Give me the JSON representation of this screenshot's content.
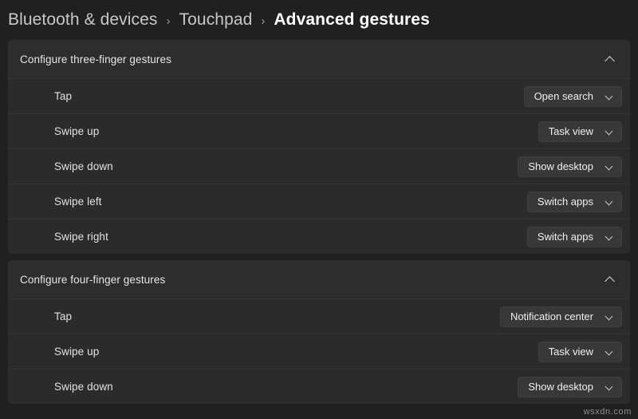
{
  "breadcrumb": {
    "separator": "›",
    "items": [
      {
        "label": "Bluetooth & devices",
        "current": false
      },
      {
        "label": "Touchpad",
        "current": false
      },
      {
        "label": "Advanced gestures",
        "current": true
      }
    ]
  },
  "sections": [
    {
      "title": "Configure three-finger gestures",
      "collapse_icon": "chevron-up-icon",
      "rows": [
        {
          "label": "Tap",
          "value": "Open search",
          "dropdown_icon": "chevron-down-icon"
        },
        {
          "label": "Swipe up",
          "value": "Task view",
          "dropdown_icon": "chevron-down-icon"
        },
        {
          "label": "Swipe down",
          "value": "Show desktop",
          "dropdown_icon": "chevron-down-icon"
        },
        {
          "label": "Swipe left",
          "value": "Switch apps",
          "dropdown_icon": "chevron-down-icon"
        },
        {
          "label": "Swipe right",
          "value": "Switch apps",
          "dropdown_icon": "chevron-down-icon"
        }
      ]
    },
    {
      "title": "Configure four-finger gestures",
      "collapse_icon": "chevron-up-icon",
      "rows": [
        {
          "label": "Tap",
          "value": "Notification center",
          "dropdown_icon": "chevron-down-icon"
        },
        {
          "label": "Swipe up",
          "value": "Task view",
          "dropdown_icon": "chevron-down-icon"
        },
        {
          "label": "Swipe down",
          "value": "Show desktop",
          "dropdown_icon": "chevron-down-icon"
        }
      ]
    }
  ],
  "watermark": "wsxdn.com",
  "colors": {
    "page_background": "#202020",
    "card_background": "#2b2b2b",
    "section_header_background": "#2d2d2d",
    "dropdown_background": "#383838",
    "divider": "#353535",
    "text_primary": "#ffffff",
    "text_secondary": "#c8c8c8"
  }
}
